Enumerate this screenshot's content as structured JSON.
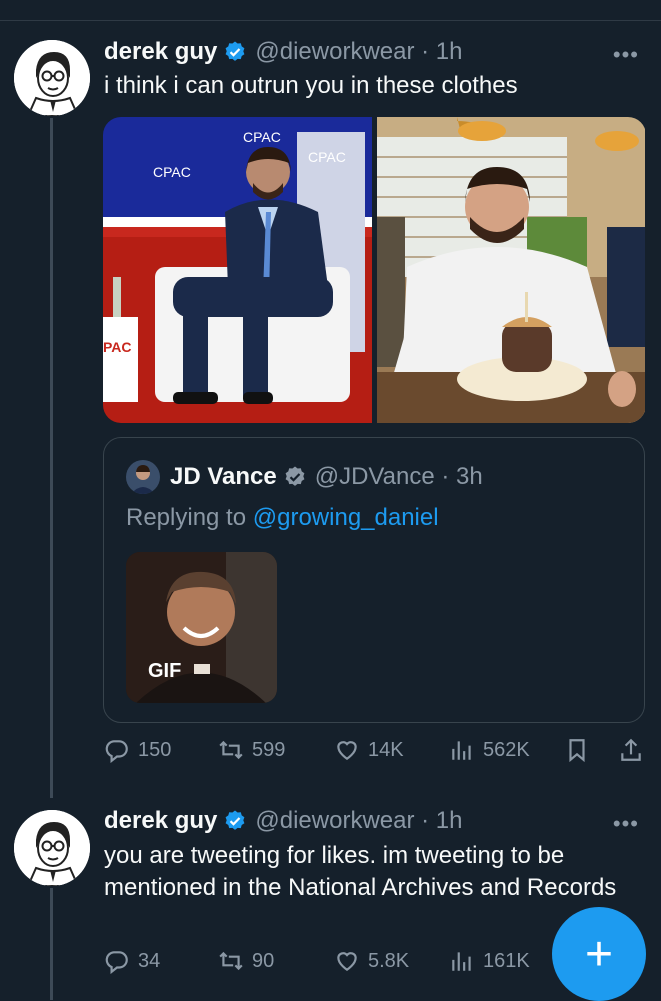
{
  "tweet1": {
    "name": "derek guy",
    "handle": "@dieworkwear · 1h",
    "text": "i think i can outrun you in these clothes",
    "more": "•••",
    "quote": {
      "name": "JD Vance",
      "handle": "@JDVance · 3h",
      "replying_prefix": "Replying to ",
      "replying_mention": "@growing_daniel",
      "gif_label": "GIF"
    },
    "stats": {
      "replies": "150",
      "retweets": "599",
      "likes": "14K",
      "views": "562K"
    }
  },
  "tweet2": {
    "name": "derek guy",
    "handle": "@dieworkwear · 1h",
    "text": "you are tweeting for likes. im tweeting to be mentioned in the National Archives and Records",
    "more": "•••",
    "stats": {
      "replies": "34",
      "retweets": "90",
      "likes": "5.8K",
      "views": "161K"
    }
  },
  "fab_label": "+",
  "media_text": {
    "sign1": "CPAC",
    "sign2": "CPAC",
    "sign3": "CPAC",
    "sign4": "PAC"
  },
  "colors": {
    "background": "#15202b",
    "accent": "#1d9bf0",
    "muted": "#8b98a5",
    "border": "#38444d"
  },
  "icons": [
    "verified-badge-icon",
    "more-icon",
    "reply-icon",
    "retweet-icon",
    "like-icon",
    "views-icon",
    "bookmark-icon",
    "share-icon",
    "compose-icon"
  ]
}
